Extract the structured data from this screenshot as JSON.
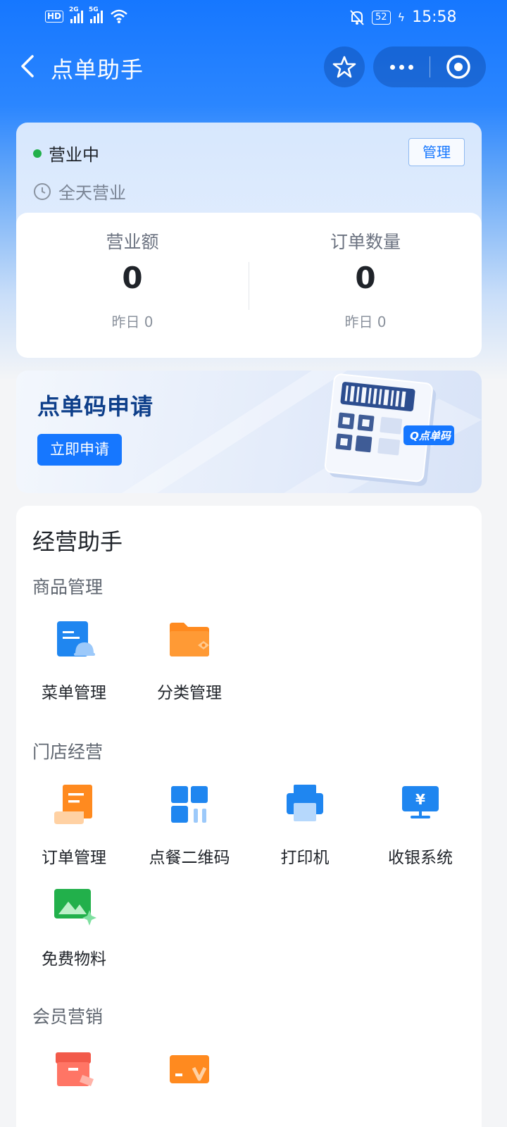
{
  "status_bar": {
    "network_hd": "HD",
    "sig1": "2G",
    "sig2": "5G",
    "battery": "52",
    "time": "15:58"
  },
  "nav": {
    "title": "点单助手"
  },
  "store": {
    "status": "营业中",
    "manage_label": "管理",
    "hours": "全天营业",
    "stats": [
      {
        "label": "营业额",
        "value": "0",
        "yesterday": "昨日 0"
      },
      {
        "label": "订单数量",
        "value": "0",
        "yesterday": "昨日 0"
      }
    ],
    "status_color": "#22b04b"
  },
  "banner": {
    "title": "点单码申请",
    "button": "立即申请",
    "badge": "Q点单码"
  },
  "assistant": {
    "title": "经营助手",
    "sections": [
      {
        "title": "商品管理",
        "items": [
          {
            "label": "菜单管理",
            "icon": "menu-icon"
          },
          {
            "label": "分类管理",
            "icon": "folder-icon"
          }
        ]
      },
      {
        "title": "门店经营",
        "items": [
          {
            "label": "订单管理",
            "icon": "order-icon"
          },
          {
            "label": "点餐二维码",
            "icon": "qrcode-grid-icon"
          },
          {
            "label": "打印机",
            "icon": "printer-icon"
          },
          {
            "label": "收银系统",
            "icon": "cashier-icon"
          },
          {
            "label": "免费物料",
            "icon": "image-material-icon"
          }
        ]
      },
      {
        "title": "会员营销",
        "items": [
          {
            "label": "",
            "icon": "coupon-icon"
          },
          {
            "label": "",
            "icon": "vip-card-icon"
          }
        ]
      }
    ]
  },
  "colors": {
    "primary": "#1677ff",
    "header": "#1677ff"
  }
}
